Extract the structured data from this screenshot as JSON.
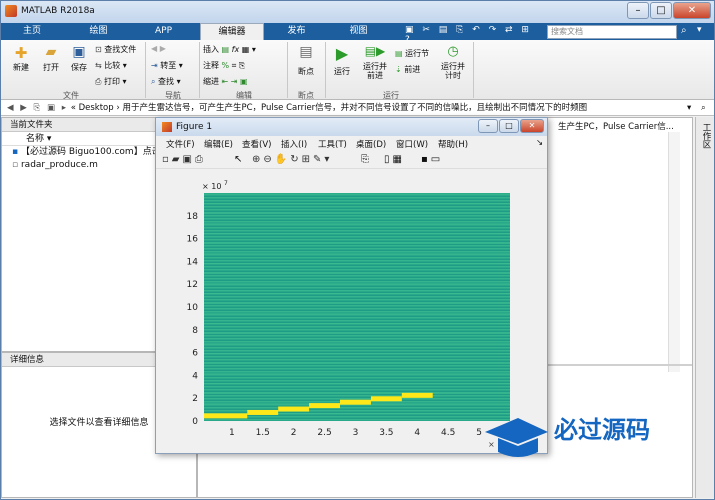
{
  "window": {
    "title": "MATLAB R2018a"
  },
  "ribbon_tabs": [
    {
      "label": "主页"
    },
    {
      "label": "绘图"
    },
    {
      "label": "APP"
    },
    {
      "label": "编辑器"
    },
    {
      "label": "发布"
    },
    {
      "label": "视图"
    }
  ],
  "search": {
    "placeholder": "搜索文档"
  },
  "ribbon": {
    "new": "新建",
    "open": "打开",
    "save": "保存",
    "find_files": "查找文件",
    "compare": "比较",
    "print": "打印",
    "goto": "转至",
    "find": "查找",
    "insert": "插入",
    "comment": "注释",
    "indent": "缩进",
    "breakpoint": "断点",
    "run": "运行",
    "run_advance": "运行并\n前进",
    "run_section": "运行节",
    "advance": "前进",
    "run_time": "运行并\n计时",
    "groups": {
      "file": "文件",
      "nav": "导航",
      "edit": "编辑",
      "breakpoint": "断点",
      "run": "运行"
    }
  },
  "address": {
    "path": "« Desktop › 用于产生雷达信号，可产生产生PC，Pulse Carrier信号，并对不同信号设置了不同的信噪比，且绘制出不同情况下的时频图"
  },
  "current_folder": {
    "title": "当前文件夹",
    "col_name": "名称",
    "files": [
      "【必过源码 Biguo100.com】点击",
      "radar_produce.m"
    ]
  },
  "details": {
    "title": "详细信息",
    "hint": "选择文件以查看详细信息"
  },
  "right_fragment": "生产生PC，Pulse Carrier信...",
  "workspace_label": "工作区",
  "figure": {
    "title": "Figure 1",
    "menus": [
      "文件(F)",
      "编辑(E)",
      "查看(V)",
      "插入(I)",
      "工具(T)",
      "桌面(D)",
      "窗口(W)",
      "帮助(H)"
    ]
  },
  "chart_data": {
    "type": "heatmap",
    "title": "",
    "xlabel": "",
    "ylabel": "",
    "y_exponent": "× 10",
    "y_exponent_power": "7",
    "x_ticks": [
      "1",
      "1.5",
      "2",
      "2.5",
      "3",
      "3.5",
      "4",
      "4.5",
      "5"
    ],
    "y_ticks": [
      "0",
      "2",
      "4",
      "6",
      "8",
      "10",
      "12",
      "14",
      "16",
      "18"
    ],
    "xlim": [
      0.55,
      5.5
    ],
    "ylim": [
      0,
      20
    ],
    "background_color": "#2aa88a",
    "trace_color": "#ffe81a",
    "trace_y": [
      0.45,
      0.75,
      1.05,
      1.35,
      1.65,
      1.95,
      2.25
    ]
  },
  "logo": {
    "cn": "必过源码",
    "url": "Biguo100.com"
  },
  "colors": {
    "ribbon_blue": "#1d5e9e",
    "accent": "#1466c0"
  }
}
